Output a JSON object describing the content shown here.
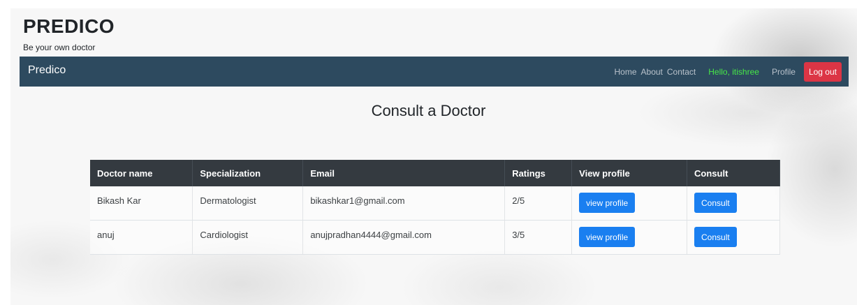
{
  "brand": {
    "title": "PREDICO",
    "tagline": "Be your own doctor"
  },
  "navbar": {
    "brand": "Predico",
    "links": {
      "home": "Home",
      "about": "About",
      "contact": "Contact"
    },
    "greeting": "Hello, itishree",
    "profile": "Profile",
    "logout": "Log out"
  },
  "colors": {
    "navbar_bg": "#2d4a5f",
    "greeting": "#47e847",
    "logout": "#dc3545",
    "primary_button": "#1a7ff0",
    "table_header": "#343a40"
  },
  "page": {
    "heading": "Consult a Doctor"
  },
  "table": {
    "headers": [
      "Doctor name",
      "Specialization",
      "Email",
      "Ratings",
      "View profile",
      "Consult"
    ],
    "rows": [
      {
        "name": "Bikash Kar",
        "specialization": "Dermatologist",
        "email": "bikashkar1@gmail.com",
        "rating": "2/5",
        "view_label": "view profile",
        "consult_label": "Consult"
      },
      {
        "name": "anuj",
        "specialization": "Cardiologist",
        "email": "anujpradhan4444@gmail.com",
        "rating": "3/5",
        "view_label": "view profile",
        "consult_label": "Consult"
      }
    ]
  }
}
